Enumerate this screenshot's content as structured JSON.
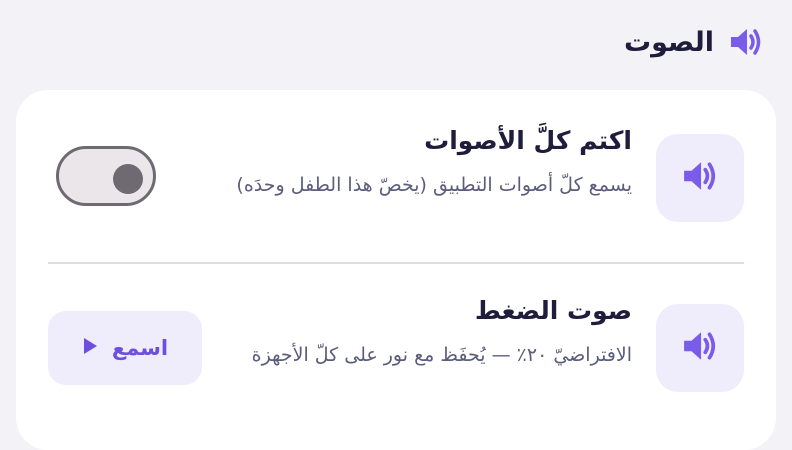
{
  "section": {
    "title": "الصوت",
    "icon": "speaker-icon"
  },
  "rows": [
    {
      "title": "اكتم كلَّ الأصوات",
      "description": "يسمع كلّ أصوات التطبيق (يخصّ هذا الطفل وحدَه)",
      "icon": "speaker-icon",
      "control": {
        "type": "toggle",
        "state": "off"
      }
    },
    {
      "title": "صوت الضغط",
      "description": "الافتراضيّ ٢٠٪ — يُحفَظ مع نور على كلّ الأجهزة",
      "icon": "speaker-icon",
      "control": {
        "type": "button",
        "label": "اسمع",
        "icon": "play-icon"
      }
    }
  ],
  "colors": {
    "accent": "#6d4fe0",
    "tile": "#efecfc",
    "background": "#f3f2f6"
  }
}
